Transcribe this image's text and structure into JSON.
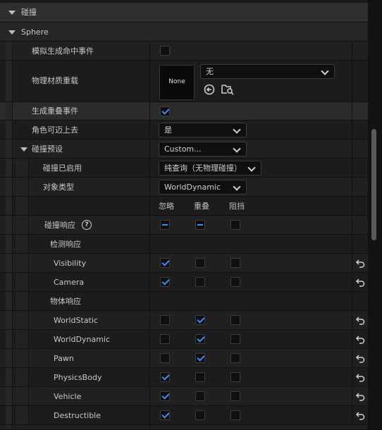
{
  "section_collision": "碰撞",
  "section_sphere": "Sphere",
  "props": {
    "sim_hit_events": "模拟生成命中事件",
    "phys_material_override": "物理材质重载",
    "material_thumb": "None",
    "material_value": "无",
    "gen_overlap_events": "生成重叠事件",
    "can_step_up": "角色可迈上去",
    "can_step_up_value": "是",
    "collision_presets": "碰撞预设",
    "collision_presets_value": "Custom...",
    "collision_enabled": "碰撞已启用",
    "collision_enabled_value": "纯查询（无物理碰撞）",
    "object_type": "对象类型",
    "object_type_value": "WorldDynamic"
  },
  "columns": {
    "ignore": "忽略",
    "overlap": "重叠",
    "block": "阻挡"
  },
  "collision_responses_label": "碰撞响应",
  "help_glyph": "?",
  "trace_responses_label": "检测响应",
  "object_responses_label": "物体响应",
  "trace_channels": [
    {
      "name": "Visibility",
      "state": "ignore"
    },
    {
      "name": "Camera",
      "state": "ignore"
    }
  ],
  "object_channels": [
    {
      "name": "WorldStatic",
      "state": "overlap"
    },
    {
      "name": "WorldDynamic",
      "state": "overlap"
    },
    {
      "name": "Pawn",
      "state": "overlap"
    },
    {
      "name": "PhysicsBody",
      "state": "ignore"
    },
    {
      "name": "Vehicle",
      "state": "ignore"
    },
    {
      "name": "Destructible",
      "state": "ignore"
    }
  ],
  "checkbox_states": {
    "sim_hit_events": false,
    "gen_overlap_events": true
  },
  "colors": {
    "accent": "#3d8bfd",
    "bg": "#1a1a1a"
  },
  "icons": [
    "chevron-down-icon",
    "use-selected-asset-icon",
    "browse-asset-icon",
    "reset-to-default-icon",
    "help-icon"
  ]
}
